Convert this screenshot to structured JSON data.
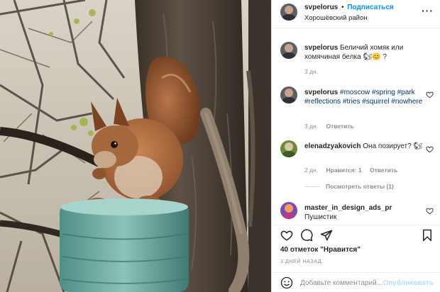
{
  "header": {
    "username": "svpelorus",
    "separator": "•",
    "follow_label": "Подписаться",
    "location": "Хорошёвский район",
    "more_icon": "ellipsis-icon"
  },
  "comments": [
    {
      "username": "svpelorus",
      "text": "Беличий хомяк или хомячиная белка",
      "emoji": "🐿😊",
      "suffix": "?",
      "time": "3 дн."
    },
    {
      "username": "svpelorus",
      "tags": "#moscow #spring #park #reflections #tries #squirrel #nowhere",
      "time": "3 дн.",
      "reply": "Ответить"
    },
    {
      "username": "elenadzyakovich",
      "text": "Она позирует?",
      "emoji": "🐿",
      "time": "2 дн.",
      "likes": "Нравится: 1",
      "reply": "Ответить"
    },
    {
      "username": "master_in_design_ads_pr",
      "text": "Пушистик"
    }
  ],
  "view_replies": "Посмотреть ответы (1)",
  "actions": {
    "likes_text": "40 отметок \"Нравится\"",
    "date_text": "3 ДНЕЙ НАЗАД"
  },
  "add_comment": {
    "placeholder": "Добавьте комментарий...",
    "post_label": "Опубликовать"
  },
  "colors": {
    "accent": "#0095f6",
    "muted": "#8e8e8e",
    "hashtag": "#00376b",
    "post_disabled": "#b2dffc"
  }
}
